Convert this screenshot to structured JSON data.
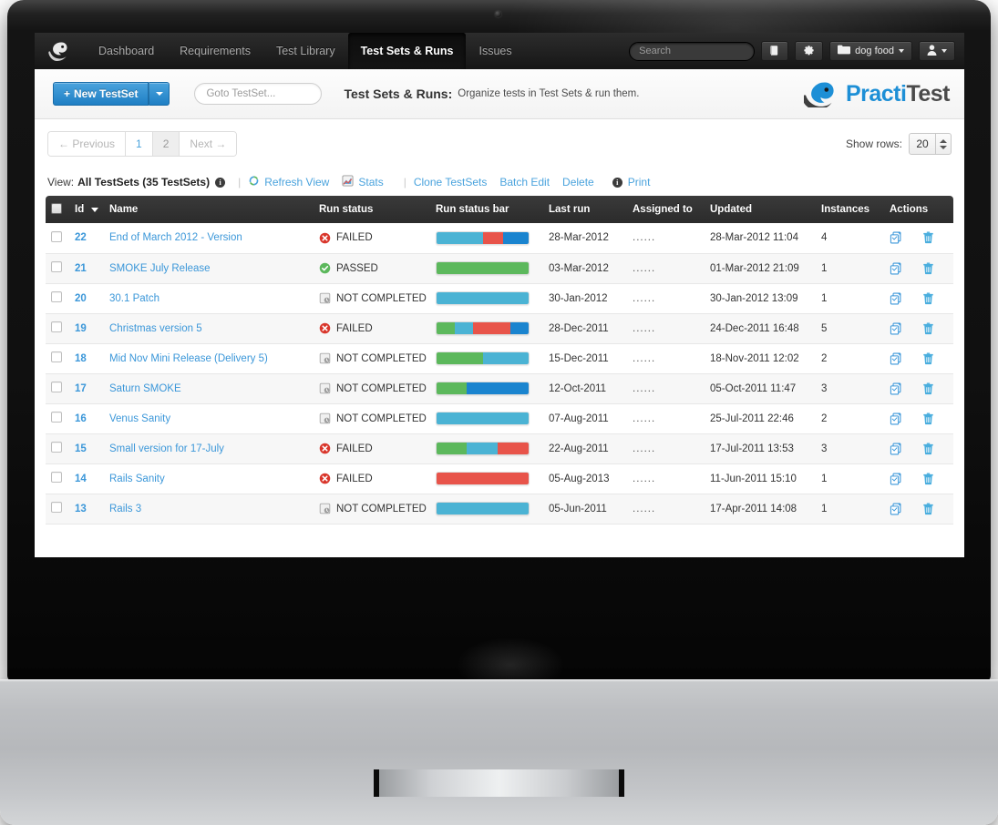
{
  "app": {
    "brand_logo": "practitest-bird-logo",
    "product_name_part1": "Practi",
    "product_name_part2": "Test"
  },
  "navbar": {
    "links": [
      {
        "label": "Dashboard",
        "active": false
      },
      {
        "label": "Requirements",
        "active": false
      },
      {
        "label": "Test Library",
        "active": false
      },
      {
        "label": "Test Sets & Runs",
        "active": true
      },
      {
        "label": "Issues",
        "active": false
      }
    ],
    "search_placeholder": "Search",
    "search_value": "",
    "buttons": [
      {
        "name": "book-icon",
        "label": ""
      },
      {
        "name": "gear-icon",
        "label": ""
      },
      {
        "name": "project-selector",
        "label": "dog food",
        "icon": "folder-icon",
        "caret": true
      },
      {
        "name": "user-menu",
        "label": "",
        "icon": "user-icon",
        "caret": true
      }
    ]
  },
  "subheader": {
    "new_button_label": "New TestSet",
    "new_button_plus": "+",
    "goto_placeholder": "Goto TestSet...",
    "goto_value": "",
    "title": "Test Sets & Runs:",
    "subtitle": "Organize tests in Test Sets & run them."
  },
  "pagination": {
    "previous_label": "← Previous",
    "pages": [
      {
        "label": "1",
        "current": false
      },
      {
        "label": "2",
        "current": true
      }
    ],
    "next_label": "Next →"
  },
  "show_rows": {
    "label": "Show rows:",
    "value": "20"
  },
  "view_toolbar": {
    "view_label": "View:",
    "view_name": "All TestSets (35 TestSets)",
    "info_glyph": "i",
    "separator": "|",
    "actions": [
      {
        "label": "Refresh View",
        "icon": "refresh-icon"
      },
      {
        "label": "Stats",
        "icon": "stats-icon"
      },
      {
        "label": "Clone TestSets",
        "icon": ""
      },
      {
        "label": "Batch Edit",
        "icon": ""
      },
      {
        "label": "Delete",
        "icon": ""
      },
      {
        "label": "Print",
        "icon": ""
      }
    ]
  },
  "table": {
    "columns": [
      {
        "key": "checkbox",
        "label": ""
      },
      {
        "key": "id",
        "label": "Id",
        "sorted": true,
        "sort_dir": "desc"
      },
      {
        "key": "name",
        "label": "Name"
      },
      {
        "key": "run_status",
        "label": "Run status"
      },
      {
        "key": "run_status_bar",
        "label": "Run status bar"
      },
      {
        "key": "last_run",
        "label": "Last run"
      },
      {
        "key": "assigned_to",
        "label": "Assigned to"
      },
      {
        "key": "updated",
        "label": "Updated"
      },
      {
        "key": "instances",
        "label": "Instances"
      },
      {
        "key": "actions",
        "label": "Actions"
      }
    ],
    "action_icons": [
      {
        "name": "clone-icon",
        "color": "#3b97d9"
      },
      {
        "name": "delete-trash-icon",
        "color": "#3b97d9"
      }
    ],
    "assigned_placeholder": "......",
    "rows": [
      {
        "id": "22",
        "name": "End of March 2012 - Version",
        "run_status": "FAILED",
        "status_icon": "failed-icon",
        "bar": [
          {
            "color": "#4bb3d4",
            "pct": 50
          },
          {
            "color": "#e8544a",
            "pct": 22
          },
          {
            "color": "#1a84cf",
            "pct": 28
          }
        ],
        "last_run": "28-Mar-2012",
        "assigned_to": "......",
        "updated": "28-Mar-2012 11:04",
        "instances": "4"
      },
      {
        "id": "21",
        "name": "SMOKE July Release",
        "run_status": "PASSED",
        "status_icon": "passed-icon",
        "bar": [
          {
            "color": "#5cb85c",
            "pct": 100
          }
        ],
        "last_run": "03-Mar-2012",
        "assigned_to": "......",
        "updated": "01-Mar-2012 21:09",
        "instances": "1"
      },
      {
        "id": "20",
        "name": "30.1 Patch",
        "run_status": "NOT COMPLETED",
        "status_icon": "not-completed-icon",
        "bar": [
          {
            "color": "#4bb3d4",
            "pct": 100
          }
        ],
        "last_run": "30-Jan-2012",
        "assigned_to": "......",
        "updated": "30-Jan-2012 13:09",
        "instances": "1"
      },
      {
        "id": "19",
        "name": "Christmas version 5",
        "run_status": "FAILED",
        "status_icon": "failed-icon",
        "bar": [
          {
            "color": "#5cb85c",
            "pct": 20
          },
          {
            "color": "#4bb3d4",
            "pct": 20
          },
          {
            "color": "#e8544a",
            "pct": 40
          },
          {
            "color": "#1a84cf",
            "pct": 20
          }
        ],
        "last_run": "28-Dec-2011",
        "assigned_to": "......",
        "updated": "24-Dec-2011 16:48",
        "instances": "5"
      },
      {
        "id": "18",
        "name": "Mid Nov Mini Release (Delivery 5)",
        "run_status": "NOT COMPLETED",
        "status_icon": "not-completed-icon",
        "bar": [
          {
            "color": "#5cb85c",
            "pct": 50
          },
          {
            "color": "#4bb3d4",
            "pct": 50
          }
        ],
        "last_run": "15-Dec-2011",
        "assigned_to": "......",
        "updated": "18-Nov-2011 12:02",
        "instances": "2"
      },
      {
        "id": "17",
        "name": "Saturn SMOKE",
        "run_status": "NOT COMPLETED",
        "status_icon": "not-completed-icon",
        "bar": [
          {
            "color": "#5cb85c",
            "pct": 33
          },
          {
            "color": "#1a84cf",
            "pct": 67
          }
        ],
        "last_run": "12-Oct-2011",
        "assigned_to": "......",
        "updated": "05-Oct-2011 11:47",
        "instances": "3"
      },
      {
        "id": "16",
        "name": "Venus Sanity",
        "run_status": "NOT COMPLETED",
        "status_icon": "not-completed-icon",
        "bar": [
          {
            "color": "#4bb3d4",
            "pct": 100
          }
        ],
        "last_run": "07-Aug-2011",
        "assigned_to": "......",
        "updated": "25-Jul-2011 22:46",
        "instances": "2"
      },
      {
        "id": "15",
        "name": "Small version for 17-July",
        "run_status": "FAILED",
        "status_icon": "failed-icon",
        "bar": [
          {
            "color": "#5cb85c",
            "pct": 33
          },
          {
            "color": "#4bb3d4",
            "pct": 33
          },
          {
            "color": "#e8544a",
            "pct": 34
          }
        ],
        "last_run": "22-Aug-2011",
        "assigned_to": "......",
        "updated": "17-Jul-2011 13:53",
        "instances": "3"
      },
      {
        "id": "14",
        "name": "Rails Sanity",
        "run_status": "FAILED",
        "status_icon": "failed-icon",
        "bar": [
          {
            "color": "#e8544a",
            "pct": 100
          }
        ],
        "last_run": "05-Aug-2013",
        "assigned_to": "......",
        "updated": "11-Jun-2011 15:10",
        "instances": "1"
      },
      {
        "id": "13",
        "name": "Rails 3",
        "run_status": "NOT COMPLETED",
        "status_icon": "not-completed-icon",
        "bar": [
          {
            "color": "#4bb3d4",
            "pct": 100
          }
        ],
        "last_run": "05-Jun-2011",
        "assigned_to": "......",
        "updated": "17-Apr-2011 14:08",
        "instances": "1"
      }
    ]
  },
  "colors": {
    "accent_blue": "#3b97d9",
    "passed_green": "#5cb85c",
    "failed_red": "#e8544a",
    "not_run_light_blue": "#4bb3d4",
    "blocked_dark_blue": "#1a84cf",
    "nav_dark": "#1a1a1a"
  }
}
